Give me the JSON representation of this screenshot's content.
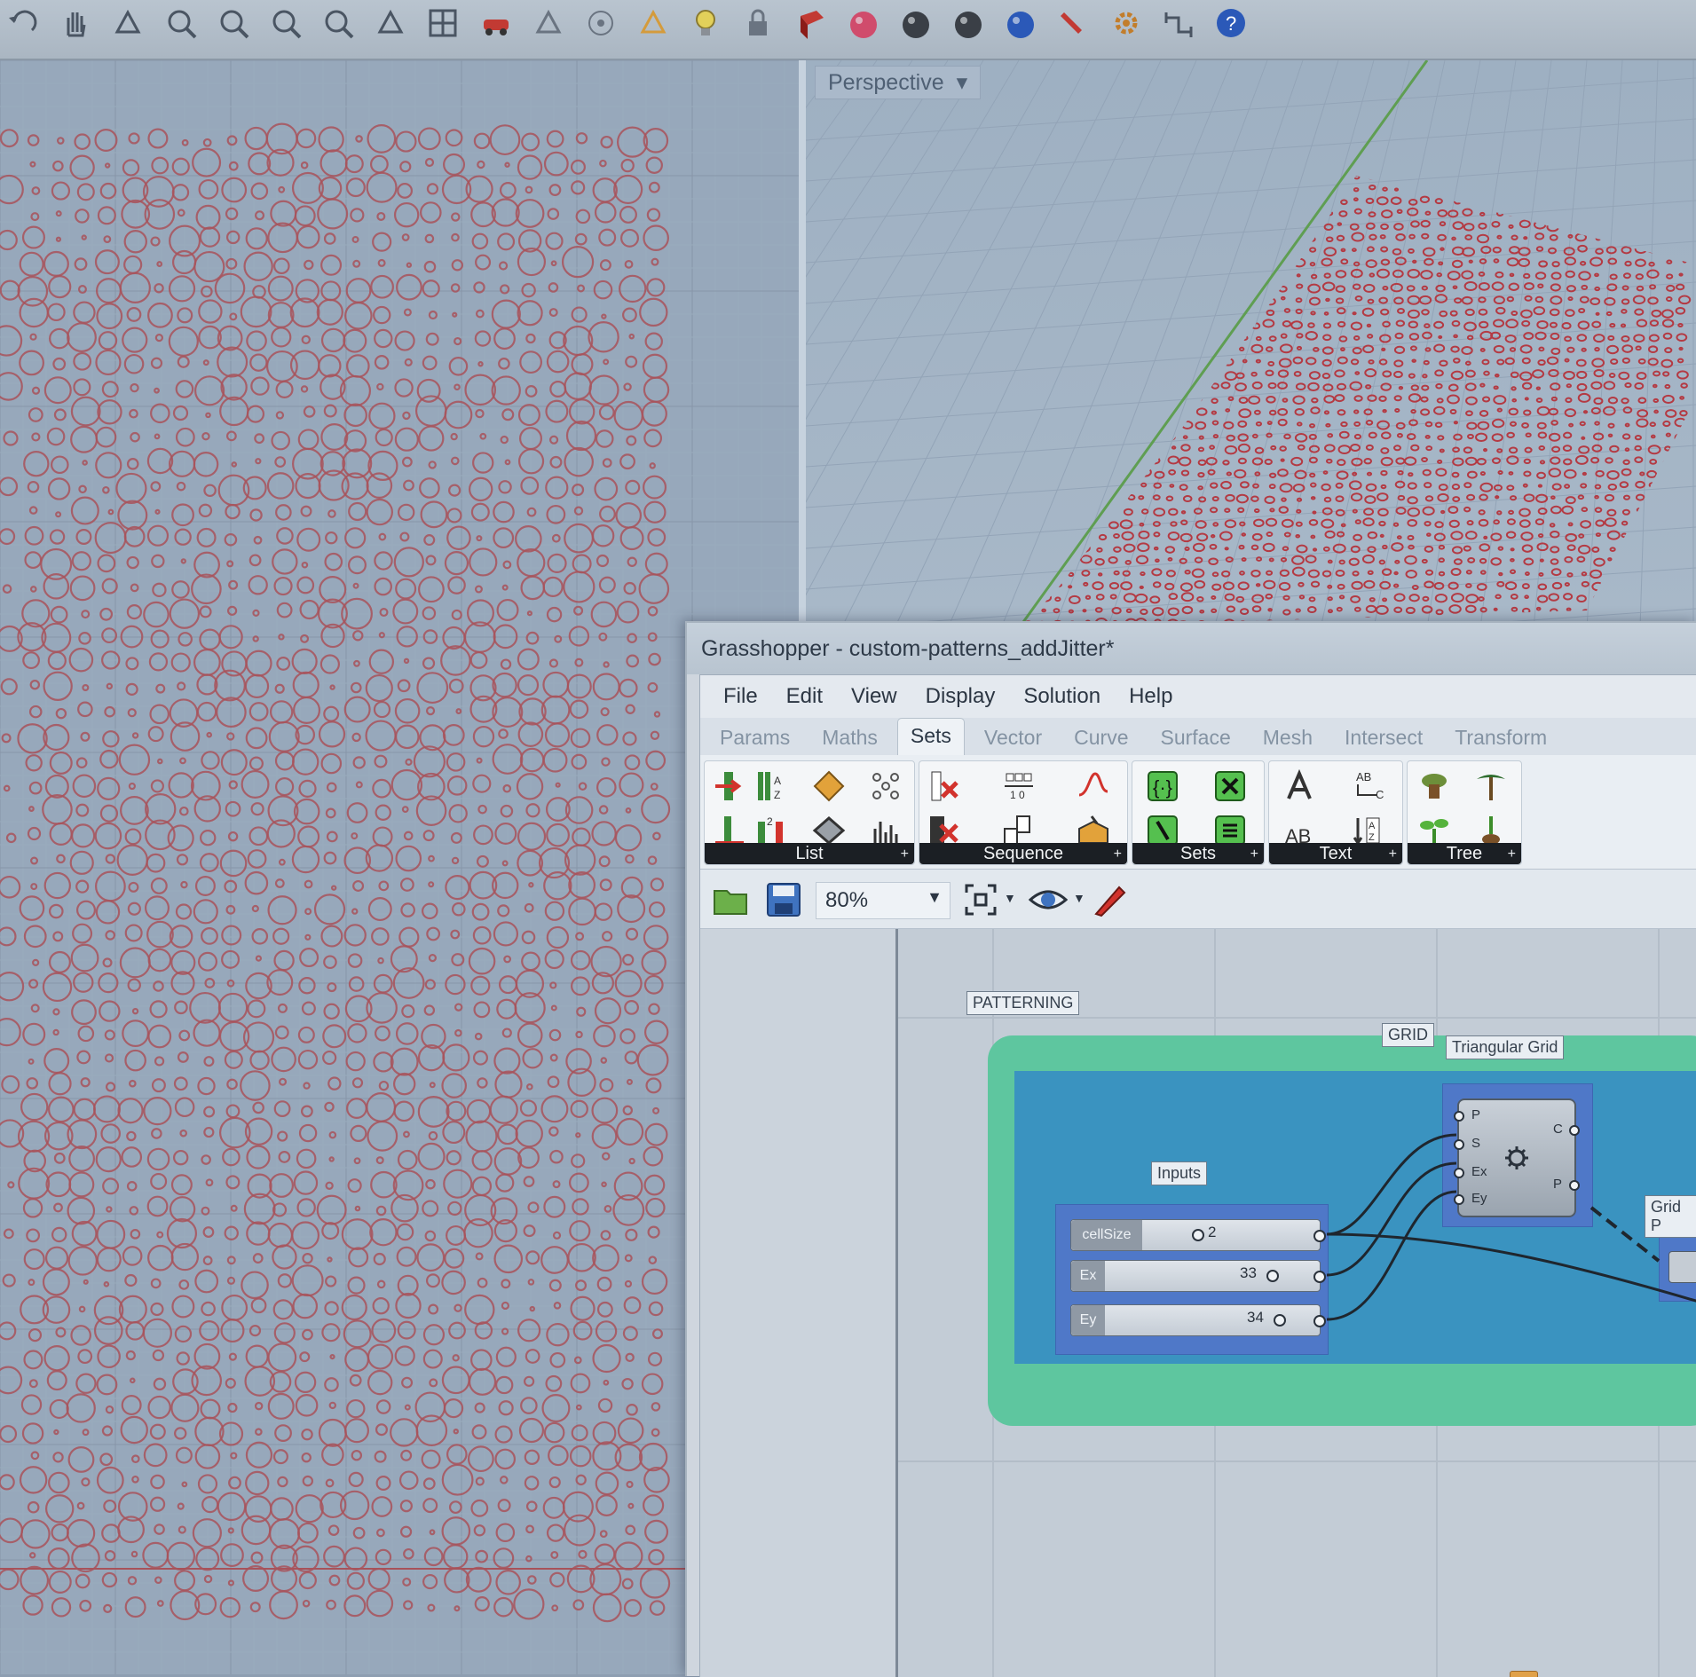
{
  "rhino": {
    "toolbar_icons": [
      "undo-icon",
      "pan-hand-icon",
      "rotate-view-icon",
      "zoom-dynamic-icon",
      "zoom-window-icon",
      "zoom-extents-icon",
      "zoom-selected-icon",
      "rotate-icon",
      "four-viewports-icon",
      "car-camera-icon",
      "display-options-icon",
      "target-icon",
      "lights-icon",
      "lightbulb-icon",
      "lock-icon",
      "render-book-icon",
      "color-wheel-icon",
      "shaded-sphere-icon",
      "rendered-sphere-icon",
      "blue-sphere-icon",
      "marker-icon",
      "gear-settings-icon",
      "dimension-icon",
      "help-icon"
    ],
    "perspective_viewport": {
      "label": "Perspective",
      "dropdown": "▾"
    },
    "top_viewport": {
      "pattern_color": "#a8525a"
    }
  },
  "grasshopper": {
    "title": "Grasshopper - custom-patterns_addJitter*",
    "menu": [
      "File",
      "Edit",
      "View",
      "Display",
      "Solution",
      "Help"
    ],
    "tabs": [
      "Params",
      "Maths",
      "Sets",
      "Vector",
      "Curve",
      "Surface",
      "Mesh",
      "Intersect",
      "Transform"
    ],
    "active_tab": "Sets",
    "ribbon_panels": [
      {
        "label": "List",
        "arrow": "+"
      },
      {
        "label": "Sequence",
        "arrow": "+"
      },
      {
        "label": "Sets",
        "arrow": "+"
      },
      {
        "label": "Text",
        "arrow": "+"
      },
      {
        "label": "Tree",
        "arrow": "+"
      }
    ],
    "canvas_toolbar": {
      "zoom": "80%"
    },
    "canvas": {
      "groups": {
        "patterning": "PATTERNING",
        "grid": "GRID",
        "inputs": "Inputs",
        "triangular_grid": "Triangular Grid",
        "grid_p": "Grid P"
      },
      "sliders": [
        {
          "name": "cellSize",
          "value": "2"
        },
        {
          "name": "Ex",
          "value": "33"
        },
        {
          "name": "Ey",
          "value": "34"
        }
      ],
      "triangular_grid_ports": {
        "inputs": [
          "P",
          "S",
          "Ex",
          "Ey"
        ],
        "outputs": [
          "C",
          "P"
        ]
      },
      "colors": {
        "patterning_group": "#5ec69f",
        "grid_group": "#3a93c0",
        "inputs_group": "#4f78c8"
      }
    }
  }
}
